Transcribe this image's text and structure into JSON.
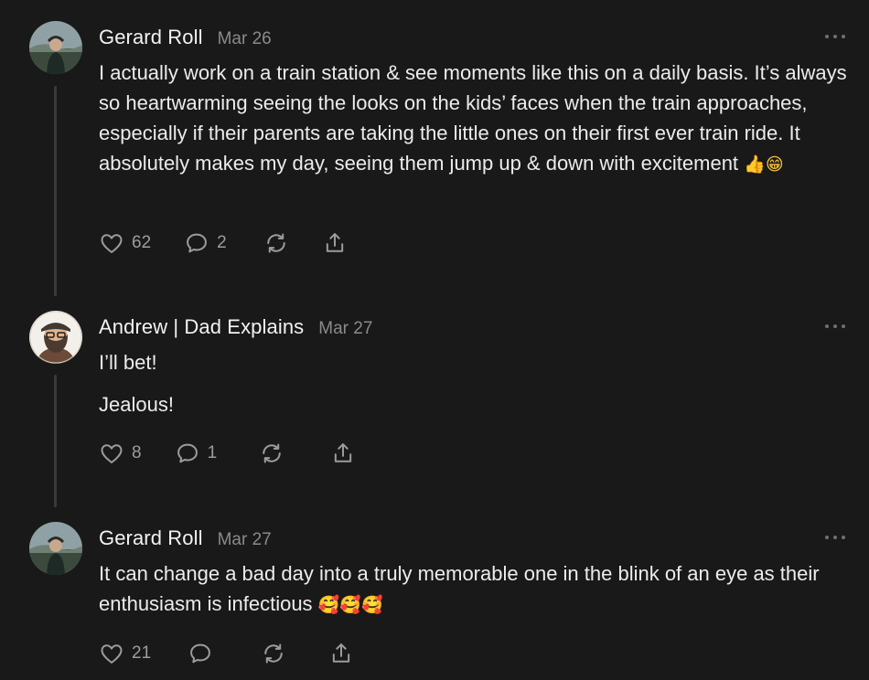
{
  "comments": [
    {
      "author": "Gerard Roll",
      "date": "Mar 26",
      "avatar_icon": "avatar-gerard-roll",
      "paragraphs": [
        "I actually work on a train station & see moments like this on a daily basis. It’s always so heartwarming seeing the looks on the kids’ faces when the train approaches, especially if their parents are taking the little ones on their first ever train ride. It absolutely makes my day, seeing them jump up & down with excitement"
      ],
      "trailing_emoji": "👍😁",
      "likes": "62",
      "replies": "2"
    },
    {
      "author": "Andrew | Dad Explains",
      "date": "Mar 27",
      "avatar_icon": "avatar-andrew-dad-explains",
      "paragraphs": [
        "I’ll bet!",
        "Jealous!"
      ],
      "likes": "8",
      "replies": "1"
    },
    {
      "author": "Gerard Roll",
      "date": "Mar 27",
      "avatar_icon": "avatar-gerard-roll",
      "paragraphs": [
        "It can change a bad day into a truly memorable one in the blink of an eye as their enthusiasm is infectious"
      ],
      "trailing_emoji": "🥰🥰🥰",
      "likes": "21",
      "replies": ""
    }
  ],
  "icons": {
    "like": "heart-icon",
    "comment": "comment-bubble-icon",
    "restack": "restack-icon",
    "share": "share-icon",
    "more": "more-options-icon"
  },
  "colors": {
    "background": "#191919",
    "text": "#ececec",
    "muted": "#8a8a8a",
    "thread_line": "#3a3a3a"
  }
}
